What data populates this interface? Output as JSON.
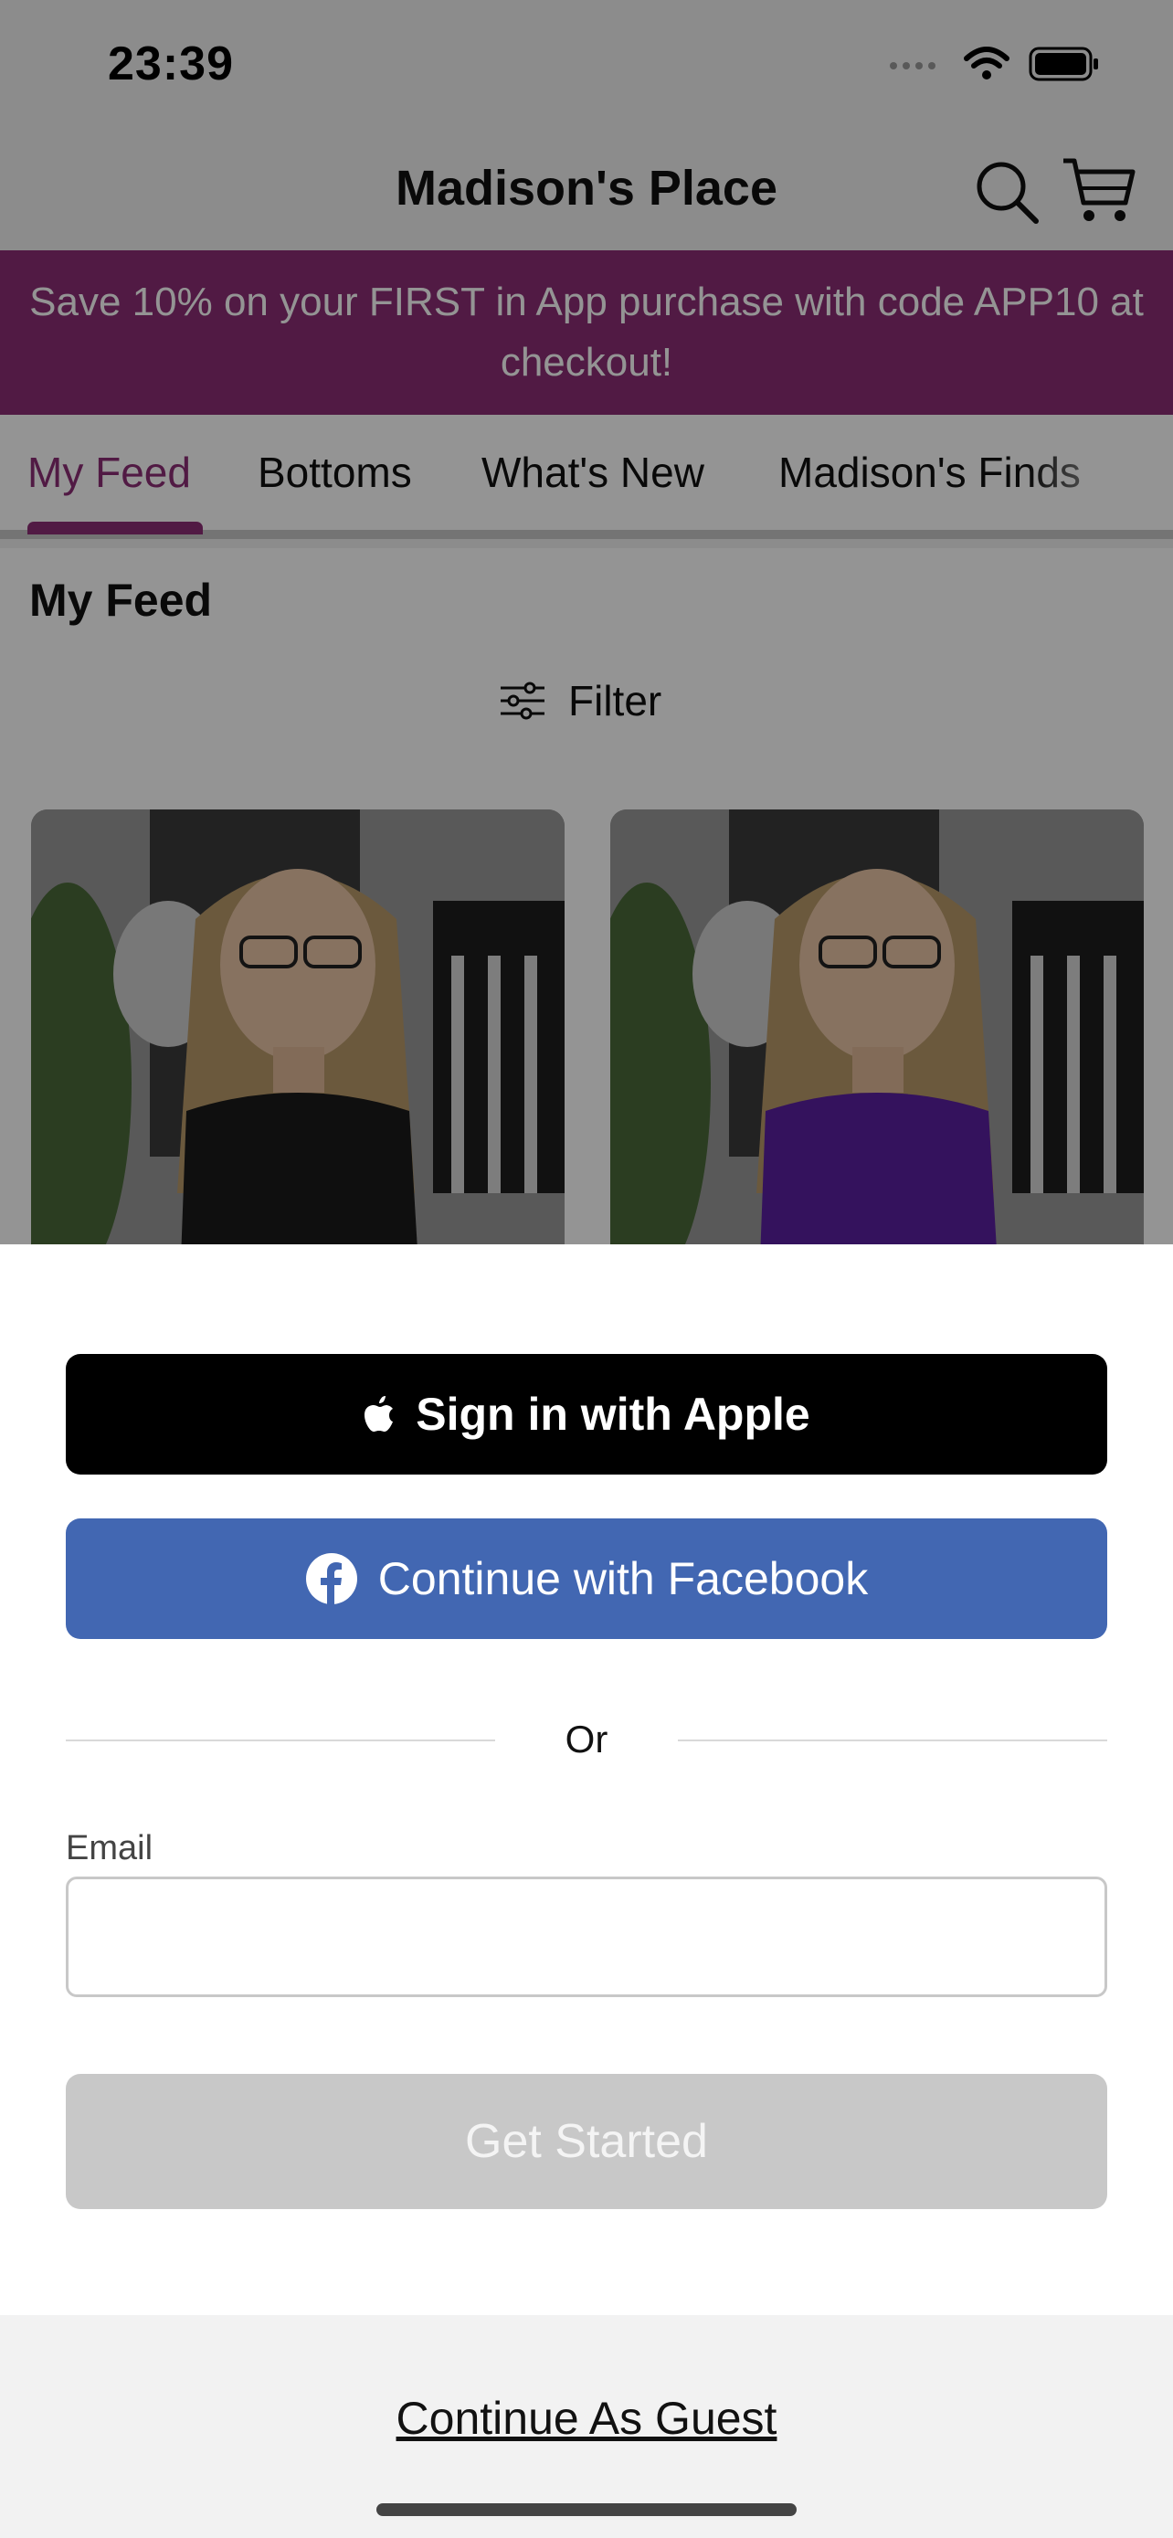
{
  "status_bar": {
    "time": "23:39"
  },
  "header": {
    "title": "Madison's Place"
  },
  "banner": {
    "text": "Save 10% on your FIRST in App purchase with code APP10 at checkout!"
  },
  "tabs": [
    {
      "label": "My Feed",
      "active": true
    },
    {
      "label": "Bottoms",
      "active": false
    },
    {
      "label": "What's New",
      "active": false
    },
    {
      "label": "Madison's Finds",
      "active": false
    }
  ],
  "feed": {
    "title": "My Feed",
    "filter_label": "Filter"
  },
  "products": [
    {
      "name": "product-black-top",
      "top_color": "#1a1a1a"
    },
    {
      "name": "product-purple-top",
      "top_color": "#5a1fa0"
    }
  ],
  "sheet": {
    "apple_label": "Sign in with Apple",
    "facebook_label": "Continue with Facebook",
    "divider_text": "Or",
    "email_label": "Email",
    "email_value": "",
    "email_placeholder": "",
    "get_started_label": "Get Started",
    "guest_label": "Continue As Guest"
  },
  "colors": {
    "brand": "#8c2e75",
    "facebook": "#4267b2",
    "apple": "#000000",
    "disabled": "#c8c8c8"
  }
}
